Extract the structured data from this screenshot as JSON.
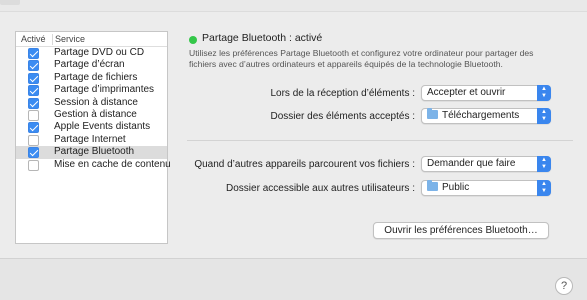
{
  "list": {
    "header_on": "Activé",
    "header_service": "Service",
    "items": [
      {
        "label": "Partage DVD ou CD",
        "checked": true,
        "selected": false
      },
      {
        "label": "Partage d’écran",
        "checked": true,
        "selected": false
      },
      {
        "label": "Partage de fichiers",
        "checked": true,
        "selected": false
      },
      {
        "label": "Partage d’imprimantes",
        "checked": true,
        "selected": false
      },
      {
        "label": "Session à distance",
        "checked": true,
        "selected": false
      },
      {
        "label": "Gestion à distance",
        "checked": false,
        "selected": false
      },
      {
        "label": "Apple Events distants",
        "checked": true,
        "selected": false
      },
      {
        "label": "Partage Internet",
        "checked": false,
        "selected": false
      },
      {
        "label": "Partage Bluetooth",
        "checked": true,
        "selected": true
      },
      {
        "label": "Mise en cache de contenu",
        "checked": false,
        "selected": false
      }
    ]
  },
  "status": {
    "text": "Partage Bluetooth : activé",
    "color": "#34c749",
    "description": "Utilisez les préférences Partage Bluetooth et configurez votre ordinateur pour partager des fichiers avec d’autres ordinateurs et appareils équipés de la technologie Bluetooth."
  },
  "settings": {
    "receive_label": "Lors de la réception d’éléments :",
    "receive_value": "Accepter et ouvrir",
    "folder_label": "Dossier des éléments acceptés :",
    "folder_value": "Téléchargements",
    "browse_label": "Quand d’autres appareils parcourent vos fichiers :",
    "browse_value": "Demander que faire",
    "shared_label": "Dossier accessible aux autres utilisateurs :",
    "shared_value": "Public"
  },
  "buttons": {
    "open_bluetooth": "Ouvrir les préférences Bluetooth…",
    "help": "?"
  },
  "colors": {
    "accent": "#3b8cf2"
  }
}
